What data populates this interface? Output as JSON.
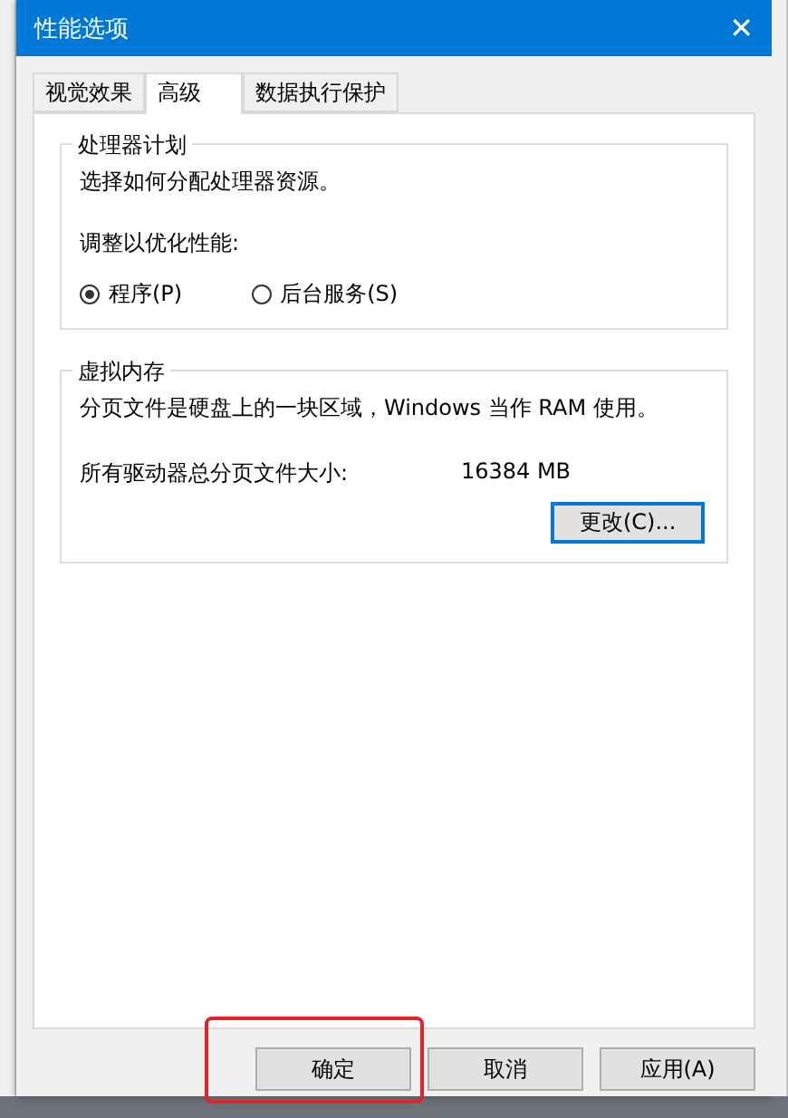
{
  "window": {
    "title": "性能选项",
    "close": "✕"
  },
  "tabs": [
    {
      "label": "视觉效果",
      "selected": false
    },
    {
      "label": "高级",
      "selected": true
    },
    {
      "label": "数据执行保护",
      "selected": false
    }
  ],
  "processor_group": {
    "title": "处理器计划",
    "description": "选择如何分配处理器资源。",
    "prompt": "调整以优化性能:",
    "options": [
      {
        "label": "程序(P)",
        "selected": true
      },
      {
        "label": "后台服务(S)",
        "selected": false
      }
    ]
  },
  "memory_group": {
    "title": "虚拟内存",
    "description": "分页文件是硬盘上的一块区域，Windows 当作 RAM 使用。",
    "size_label": "所有驱动器总分页文件大小:",
    "size_value": "16384 MB",
    "change_button": "更改(C)..."
  },
  "buttons": [
    {
      "label": "确定",
      "highlighted": true
    },
    {
      "label": "取消",
      "highlighted": false
    },
    {
      "label": "应用(A)",
      "highlighted": false
    }
  ]
}
